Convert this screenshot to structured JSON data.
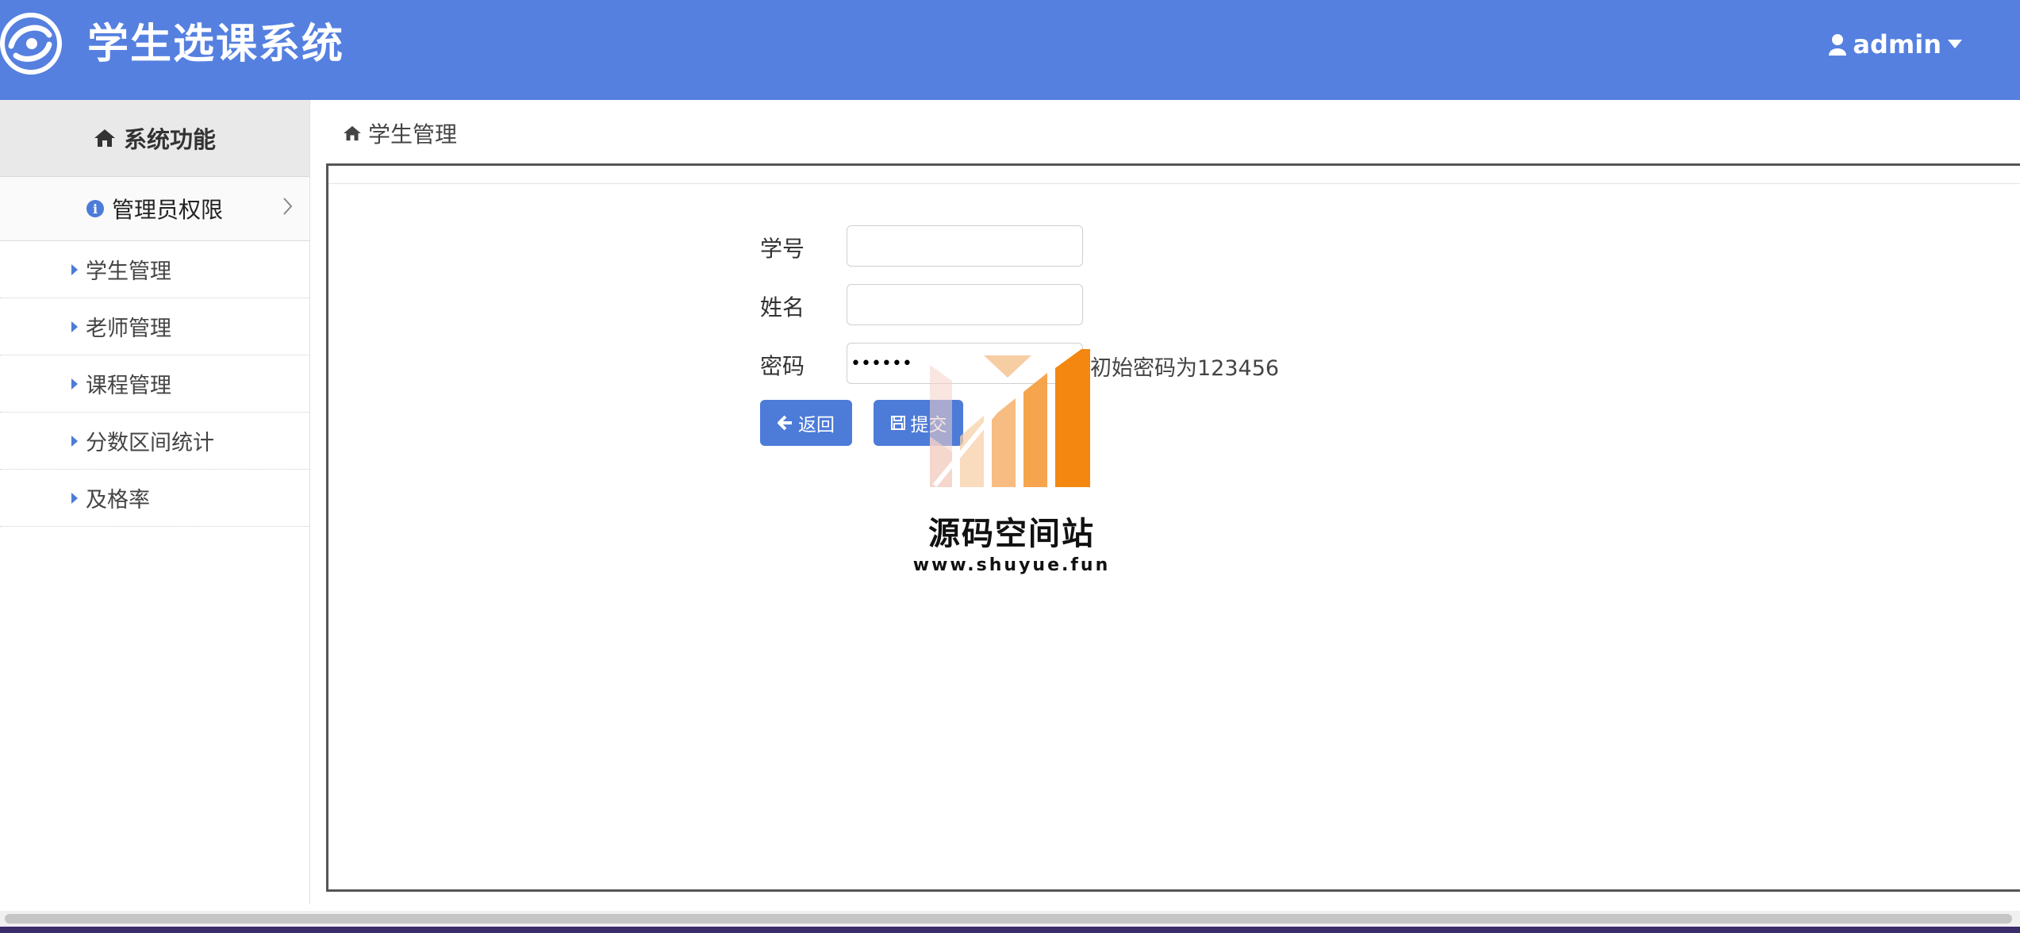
{
  "header": {
    "title": "学生选课系统",
    "user": "admin",
    "background": "#5580e0"
  },
  "sidebar": {
    "heading": "系统功能",
    "group": "管理员权限",
    "items": [
      {
        "label": "学生管理"
      },
      {
        "label": "老师管理"
      },
      {
        "label": "课程管理"
      },
      {
        "label": "分数区间统计"
      },
      {
        "label": "及格率"
      }
    ]
  },
  "breadcrumb": {
    "label": "学生管理"
  },
  "form": {
    "student_id": {
      "label": "学号",
      "value": ""
    },
    "name": {
      "label": "姓名",
      "value": ""
    },
    "password": {
      "label": "密码",
      "value": "123456",
      "hint": "初始密码为123456"
    },
    "back_button": "返回",
    "submit_button": "提交"
  },
  "watermark": {
    "title": "源码空间站",
    "url": "www.shuyue.fun"
  },
  "colors": {
    "accent": "#4d7bd8",
    "header": "#5580e0"
  }
}
